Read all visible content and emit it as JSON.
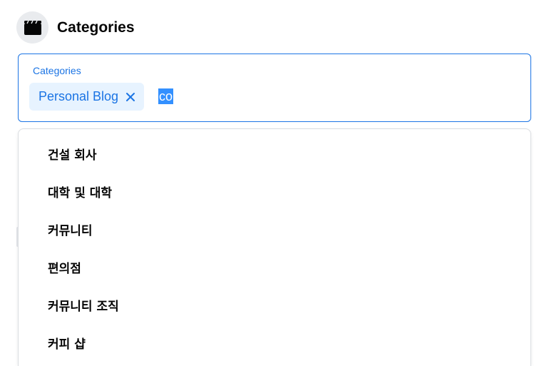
{
  "header": {
    "title": "Categories",
    "icon": "clapperboard-icon"
  },
  "field": {
    "label": "Categories",
    "selected_chips": [
      {
        "label": "Personal Blog"
      }
    ],
    "typed_value": "co"
  },
  "dropdown": {
    "options": [
      {
        "label": "건설 회사"
      },
      {
        "label": "대학 및 대학"
      },
      {
        "label": "커뮤니티"
      },
      {
        "label": "편의점"
      },
      {
        "label": "커뮤니티 조직"
      },
      {
        "label": "커피 샵"
      }
    ]
  },
  "colors": {
    "accent": "#1b74e4",
    "chip_bg": "#e7f3ff",
    "selection": "#3390ff",
    "text": "#050505"
  }
}
